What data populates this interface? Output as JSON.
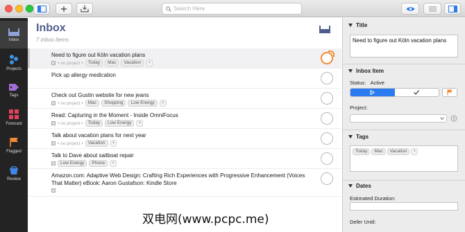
{
  "search": {
    "placeholder": "Search Here"
  },
  "sidebar": {
    "items": [
      {
        "label": "Inbox",
        "icon": "inbox-icon"
      },
      {
        "label": "Projects",
        "icon": "projects-icon"
      },
      {
        "label": "Tags",
        "icon": "tags-icon"
      },
      {
        "label": "Forecast",
        "icon": "forecast-icon"
      },
      {
        "label": "Flagged",
        "icon": "flag-icon"
      },
      {
        "label": "Review",
        "icon": "review-icon"
      }
    ]
  },
  "main": {
    "title": "Inbox",
    "subtitle": "7 inbox items",
    "tasks": [
      {
        "title": "Need to figure out Köln vacation plans",
        "project": "• no project •",
        "tags": [
          "Today",
          "Mac",
          "Vacation"
        ],
        "flagged": true
      },
      {
        "title": "Pick up allergy medication",
        "project": "",
        "tags": [],
        "flagged": false
      },
      {
        "title": "Check out Gustin website for new jeans",
        "project": "• no project •",
        "tags": [
          "Mac",
          "Shopping",
          "Low Energy"
        ],
        "flagged": false
      },
      {
        "title": "Read: Capturing in the Moment - Inside OmniFocus",
        "project": "• no project •",
        "tags": [
          "Today",
          "Low Energy"
        ],
        "flagged": false
      },
      {
        "title": "Talk about vacation plans for next year",
        "project": "• no project •",
        "tags": [
          "Vacation"
        ],
        "flagged": false
      },
      {
        "title": "Talk to Dave about sailboat repair",
        "project": "",
        "tags": [
          "Low Energy",
          "Phone"
        ],
        "flagged": false
      },
      {
        "title": "Amazon.com: Adaptive Web Design: Crafting Rich Experiences with Progressive Enhancement (Voices That Matter) eBook: Aaron Gustafson: Kindle Store",
        "project": "",
        "tags": [],
        "flagged": false
      }
    ],
    "tag_add": "+"
  },
  "inspector": {
    "title_header": "Title",
    "title_value": "Need to figure out Köln vacation plans",
    "inbox_item_header": "Inbox Item",
    "status_label": "Status:",
    "status_value": "Active",
    "project_label": "Project:",
    "tags_header": "Tags",
    "tags": [
      "Today",
      "Mac",
      "Vacation"
    ],
    "dates_header": "Dates",
    "estimated_label": "Estimated Duration:",
    "defer_label": "Defer Until:"
  },
  "watermark": "双电网(www.pcpc.me)",
  "colors": {
    "accent": "#2c7bf0",
    "flag": "#f08a36",
    "title": "#4f5e8c"
  }
}
